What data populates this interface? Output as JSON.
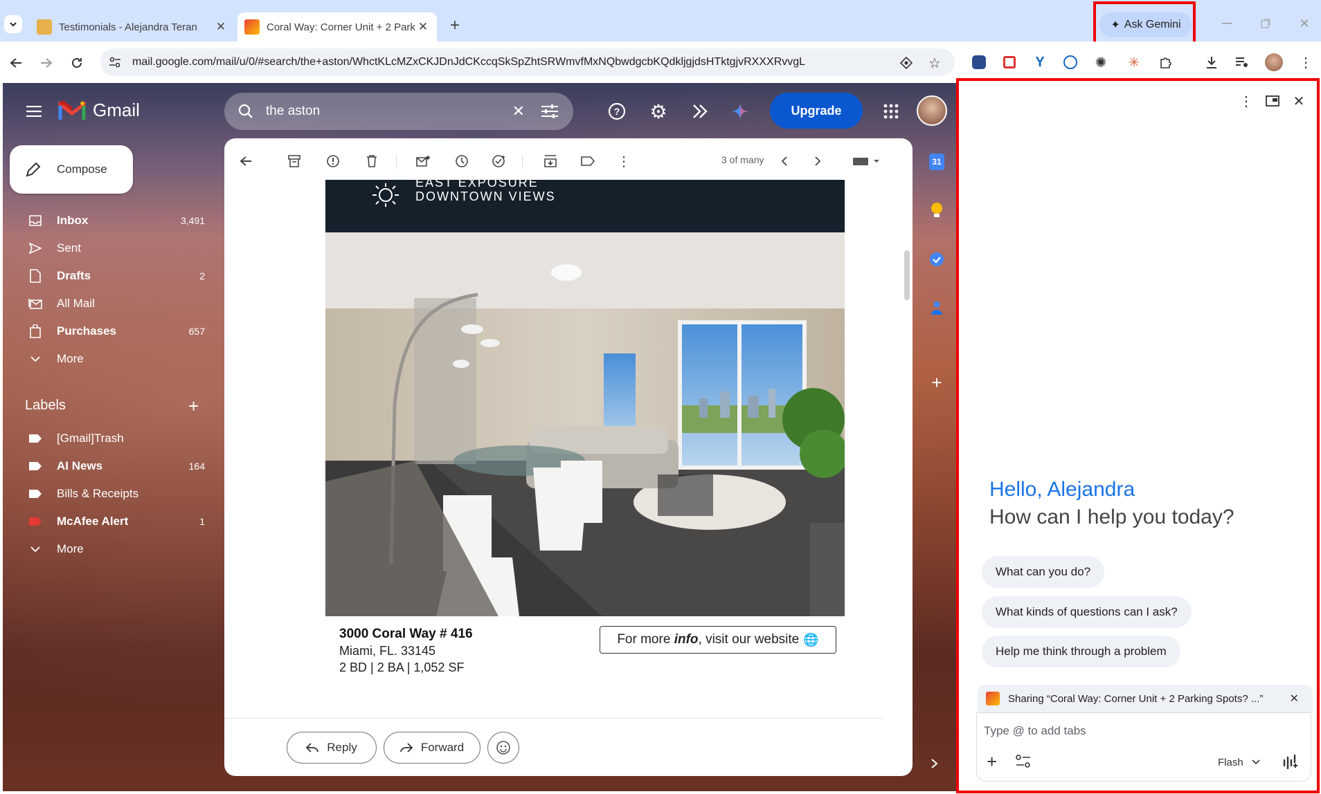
{
  "browser": {
    "tabs": [
      {
        "title": "Testimonials - Alejandra Teran",
        "active": false
      },
      {
        "title": "Coral Way: Corner Unit + 2 Park",
        "active": true
      }
    ],
    "new_tab": "+",
    "ask_gemini": "Ask Gemini",
    "url": "mail.google.com/mail/u/0/#search/the+aston/WhctKLcMZxCKJDnJdCKccqSkSpZhtSRWmvfMxNQbwdgcbKQdkljgjdsHTktgjvRXXXRvvgL"
  },
  "gmail": {
    "logo_text": "Gmail",
    "search_value": "the aston",
    "upgrade": "Upgrade",
    "compose": "Compose",
    "nav": [
      {
        "label": "Inbox",
        "count": "3,491",
        "bold": true,
        "icon": "inbox-icon"
      },
      {
        "label": "Sent",
        "count": "",
        "bold": false,
        "icon": "send-icon"
      },
      {
        "label": "Drafts",
        "count": "2",
        "bold": true,
        "icon": "draft-icon"
      },
      {
        "label": "All Mail",
        "count": "",
        "bold": false,
        "icon": "all-mail-icon"
      },
      {
        "label": "Purchases",
        "count": "657",
        "bold": true,
        "icon": "purchases-icon"
      },
      {
        "label": "More",
        "count": "",
        "bold": false,
        "icon": "chevron-down-icon"
      }
    ],
    "labels_heading": "Labels",
    "labels": [
      {
        "label": "[Gmail]Trash",
        "count": "",
        "bold": false,
        "color": "#ffffff"
      },
      {
        "label": "AI News",
        "count": "164",
        "bold": true,
        "color": "#ffffff"
      },
      {
        "label": "Bills & Receipts",
        "count": "",
        "bold": false,
        "color": "#ffffff"
      },
      {
        "label": "McAfee Alert",
        "count": "1",
        "bold": true,
        "color": "#e53935"
      },
      {
        "label": "More",
        "count": "",
        "bold": false,
        "color": ""
      }
    ],
    "pagination": "3 of many",
    "email": {
      "banner_line1": "EAST EXPOSURE",
      "banner_line2": "DOWNTOWN VIEWS",
      "address_line1": "3000 Coral Way # 416",
      "address_line2": "Miami, FL. 33145",
      "address_line3": "2 BD | 2 BA | 1,052 SF",
      "cta_pre": "For more ",
      "cta_em": "info",
      "cta_post": ", visit our website"
    },
    "reply": "Reply",
    "forward": "Forward",
    "calendar_day": "31"
  },
  "gemini": {
    "greeting": "Hello, Alejandra",
    "subtitle": "How can I help you today?",
    "suggestions": [
      "What can you do?",
      "What kinds of questions can I ask?",
      "Help me think through a problem"
    ],
    "sharing": "Sharing “Coral Way: Corner Unit + 2 Parking Spots? ...”",
    "input_placeholder": "Type @ to add tabs",
    "model": "Flash"
  },
  "colors": {
    "gemini_blue": "#1a73e8",
    "upgrade_blue": "#0b57d0",
    "highlight_red": "#e00000"
  }
}
